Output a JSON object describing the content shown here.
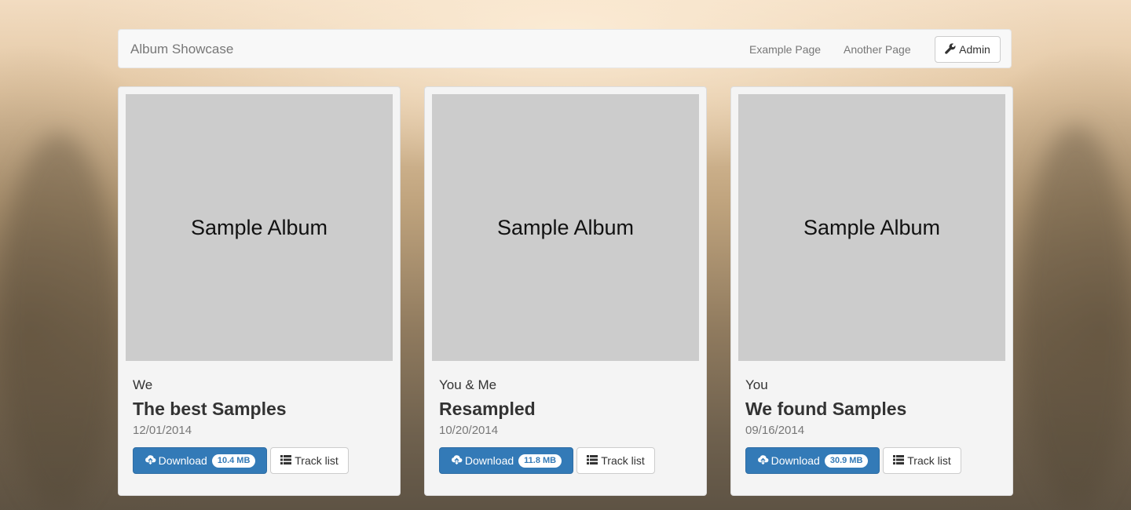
{
  "navbar": {
    "brand": "Album Showcase",
    "links": [
      "Example Page",
      "Another Page"
    ],
    "admin_label": "Admin",
    "admin_icon": "wrench-icon"
  },
  "albums": [
    {
      "cover_text": "Sample Album",
      "artist": "We",
      "title": "The best Samples",
      "date": "12/01/2014",
      "download_label": "Download",
      "size": "10.4 MB",
      "tracks_label": "Track list"
    },
    {
      "cover_text": "Sample Album",
      "artist": "You & Me",
      "title": "Resampled",
      "date": "10/20/2014",
      "download_label": "Download",
      "size": "11.8 MB",
      "tracks_label": "Track list"
    },
    {
      "cover_text": "Sample Album",
      "artist": "You",
      "title": "We found Samples",
      "date": "09/16/2014",
      "download_label": "Download",
      "size": "30.9 MB",
      "tracks_label": "Track list"
    }
  ],
  "colors": {
    "primary": "#337ab7",
    "cover_placeholder": "#cccccc",
    "navbar_bg": "#f8f8f8"
  }
}
